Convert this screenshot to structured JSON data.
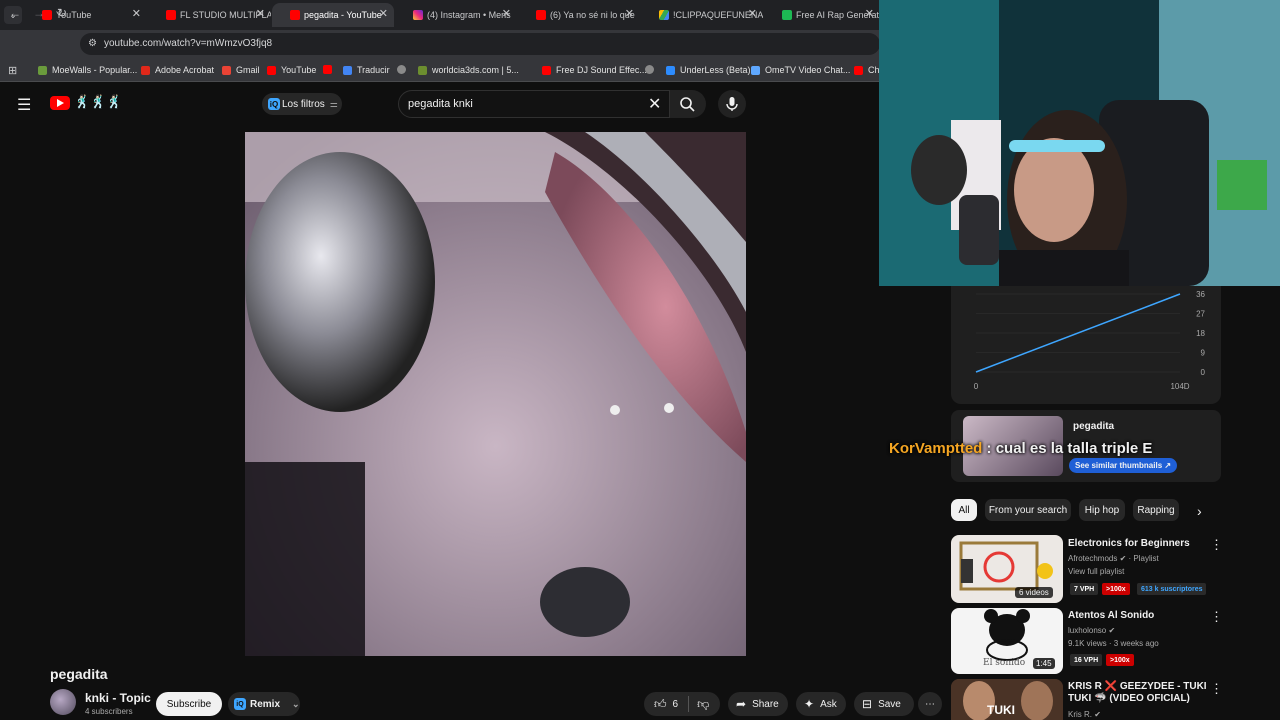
{
  "browser": {
    "tabs": [
      {
        "title": "YouTube",
        "favicon": "youtube-icon",
        "active": false
      },
      {
        "title": "FL STUDIO MULTIPLA",
        "favicon": "youtube-icon",
        "active": false
      },
      {
        "title": "pegadita - YouTube",
        "favicon": "youtube-icon",
        "active": true
      },
      {
        "title": "(4) Instagram • Mens",
        "favicon": "instagram-icon",
        "active": false
      },
      {
        "title": "(6) Ya no sé ni lo que",
        "favicon": "youtube-icon",
        "active": false
      },
      {
        "title": "!CLIPPAQUEFUNENA",
        "favicon": "drive-icon",
        "active": false
      },
      {
        "title": "Free AI Rap Generat",
        "favicon": "music-icon",
        "active": false
      }
    ],
    "url": "youtube.com/watch?v=mWmzvO3fjq8",
    "bookmarks": [
      "MoeWalls - Popular...",
      "Adobe Acrobat",
      "Gmail",
      "YouTube",
      "",
      "Traducir",
      "",
      "worldcia3ds.com | 5...",
      "Free DJ Sound Effec...",
      "",
      "UnderLess (Beta)",
      "OmeTV Video Chat...",
      "Ch"
    ]
  },
  "header": {
    "filters_label": "Los filtros",
    "search_query": "pegadita knki",
    "logo_emoji": "🕺🏻🕺🏻🕺🏻"
  },
  "video": {
    "title": "pegadita",
    "channel": "knki - Topic",
    "subscribers": "4 subscribers",
    "subscribe_label": "Subscribe",
    "remix_label": "Remix",
    "likes": "6",
    "share_label": "Share",
    "ask_label": "Ask",
    "save_label": "Save"
  },
  "stats": {
    "y_ticks": [
      "36",
      "27",
      "18",
      "9",
      "0"
    ],
    "x_ticks": [
      "0",
      "104D"
    ]
  },
  "chart_data": {
    "type": "line",
    "x": [
      0,
      104
    ],
    "series": [
      {
        "values": [
          0,
          36
        ]
      }
    ],
    "ylim": [
      0,
      36
    ],
    "grid": true
  },
  "tile": {
    "title": "pegadita",
    "button_label": "See similar thumbnails ↗"
  },
  "chat": {
    "user": "KorVamptted",
    "separator": " : ",
    "message": "cual es la talla triple E",
    "user_color": "#f5a623"
  },
  "chips": [
    "All",
    "From your search",
    "Hip hop",
    "Rapping"
  ],
  "recommendations": [
    {
      "title": "Electronics for Beginners",
      "channel": "Afrotechmods",
      "type": "Playlist",
      "extra": "View full playlist",
      "badge_vph": "7 VPH",
      "badge_mult": ">100x",
      "subs_badge": "613 k suscriptores",
      "overlay": "6 videos"
    },
    {
      "title": "Atentos Al Sonido",
      "channel": "luxholonso",
      "stats": "9.1K views · 3 weeks ago",
      "badge_vph": "16 VPH",
      "badge_mult": ">100x",
      "duration": "1:45",
      "thumb_text": "El sonido"
    },
    {
      "title_line1": "KRIS R ❌ GEEZYDEE - TUKI",
      "title_line2": "TUKI 🦈 (VIDEO OFICIAL)",
      "channel": "Kris R.",
      "thumb_text": "TUKI"
    }
  ],
  "colors": {
    "accent": "#3ea6ff",
    "brand": "#ff0000",
    "vph_badge": "#2a2a2a",
    "mult_badge": "#cc0000"
  }
}
